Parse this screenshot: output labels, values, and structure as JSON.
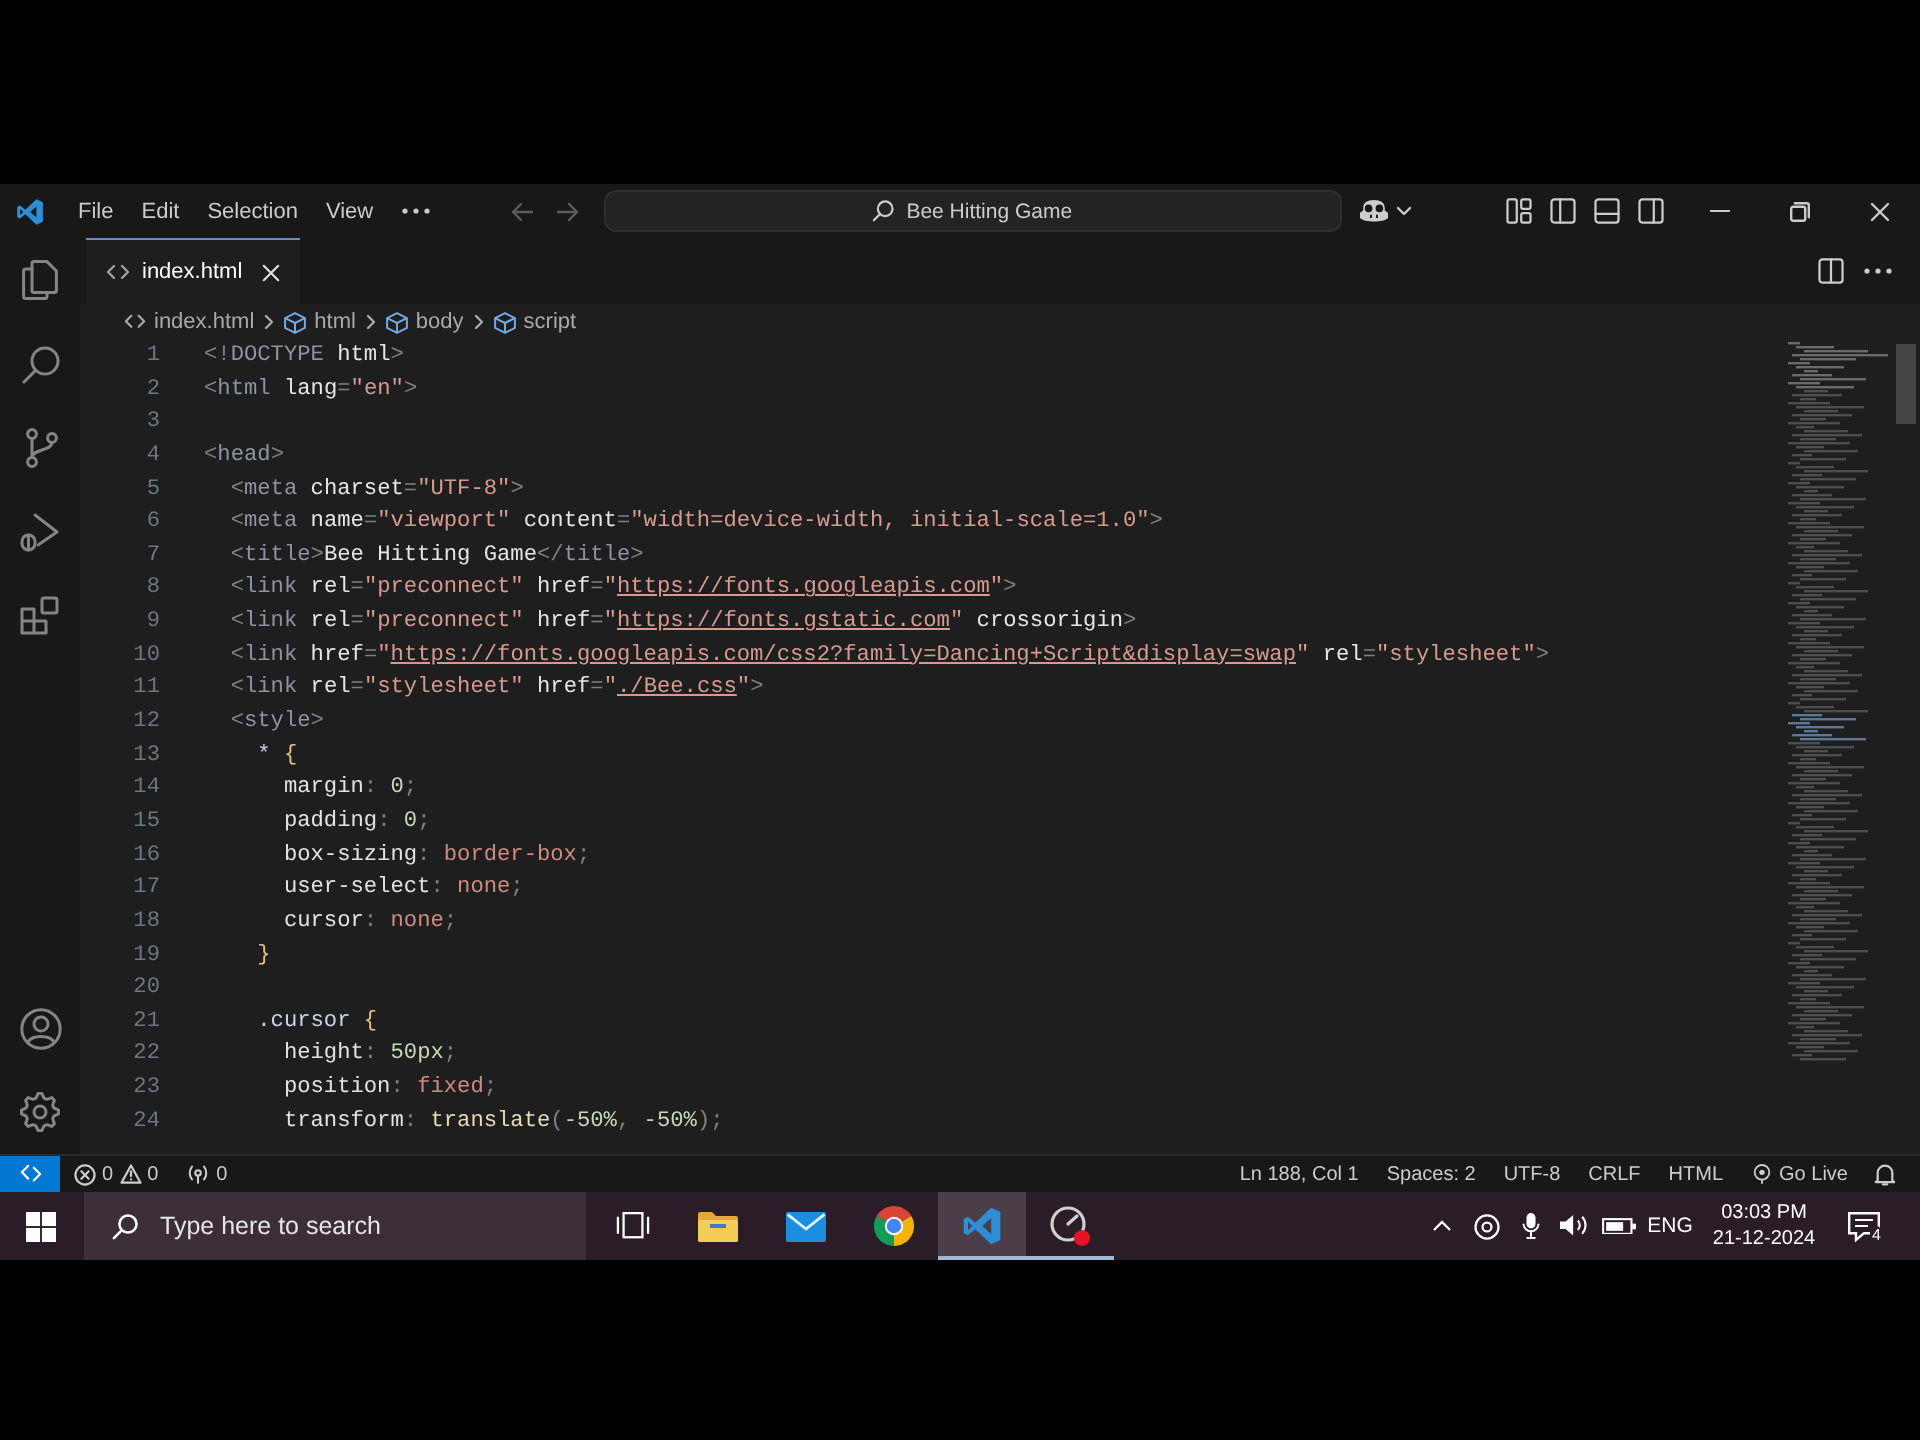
{
  "title_bar": {
    "menus": [
      "File",
      "Edit",
      "Selection",
      "View"
    ],
    "nav_buttons": [
      {
        "disabled": true
      },
      {
        "disabled": true
      }
    ],
    "command_center": {
      "label": "Bee Hitting Game"
    }
  },
  "tabs": [
    {
      "label": "index.html",
      "selected": true
    }
  ],
  "breadcrumb": [
    "index.html",
    "html",
    "body",
    "script"
  ],
  "editor": {
    "lines": [
      {
        "number": "1",
        "text": "<!DOCTYPE html>"
      },
      {
        "number": "2",
        "text": "<html lang=\"en\">"
      },
      {
        "number": "3"
      },
      {
        "number": "4",
        "text": "<head>"
      },
      {
        "number": "5",
        "text": "  <meta charset=\"UTF-8\">"
      },
      {
        "number": "6",
        "text": "  <meta name=\"viewport\" content=\"width=device-width, initial-scale=1.0\">"
      },
      {
        "number": "7",
        "text": "  <title>Bee Hitting Game</title>"
      },
      {
        "number": "8",
        "text": "  <link rel=\"preconnect\" href=\"https://fonts.googleapis.com\">"
      },
      {
        "number": "9",
        "text": "  <link rel=\"preconnect\" href=\"https://fonts.gstatic.com\" crossorigin>"
      },
      {
        "number": "10",
        "text": "  <link href=\"https://fonts.googleapis.com/css2?family=Dancing+Script&display=swap\" rel=\"stylesheet\">"
      },
      {
        "number": "11",
        "text": "  <link rel=\"stylesheet\" href=\"./Bee.css\">"
      },
      {
        "number": "12",
        "text": "  <style>"
      },
      {
        "number": "13",
        "text": "    * {"
      },
      {
        "number": "14",
        "text": "      margin: 0;"
      },
      {
        "number": "15",
        "text": "      padding: 0;"
      },
      {
        "number": "16",
        "text": "      box-sizing: border-box;"
      },
      {
        "number": "17",
        "text": "      user-select: none;"
      },
      {
        "number": "18",
        "text": "      cursor: none;"
      },
      {
        "number": "19",
        "text": "    }"
      },
      {
        "number": "20"
      },
      {
        "number": "21",
        "text": "    .cursor {"
      },
      {
        "number": "22",
        "text": "      height: 50px;"
      },
      {
        "number": "23",
        "text": "      position: fixed;"
      },
      {
        "number": "24",
        "text": "      transform: translate(-50%, -50%);"
      }
    ]
  },
  "status_bar": {
    "errors": "0",
    "warnings": "0",
    "ports": "0",
    "items": [
      "Ln 188, Col 1",
      "Spaces: 2",
      "UTF-8",
      "CRLF",
      "HTML"
    ],
    "go_live": "Go Live"
  },
  "taskbar": {
    "search": {
      "placeholder": "Type here to search"
    },
    "apps": [
      {
        "kind": "files",
        "selected": false,
        "running": false
      },
      {
        "kind": "mail",
        "selected": false,
        "running": false
      },
      {
        "kind": "browser",
        "selected": false,
        "running": false
      },
      {
        "kind": "editor",
        "selected": true,
        "running": true
      },
      {
        "kind": "recorder",
        "selected": false,
        "running": true
      }
    ],
    "tray": {
      "language": "ENG",
      "time": "03:03 PM",
      "date": "21-12-2024",
      "notifications": "4"
    }
  }
}
